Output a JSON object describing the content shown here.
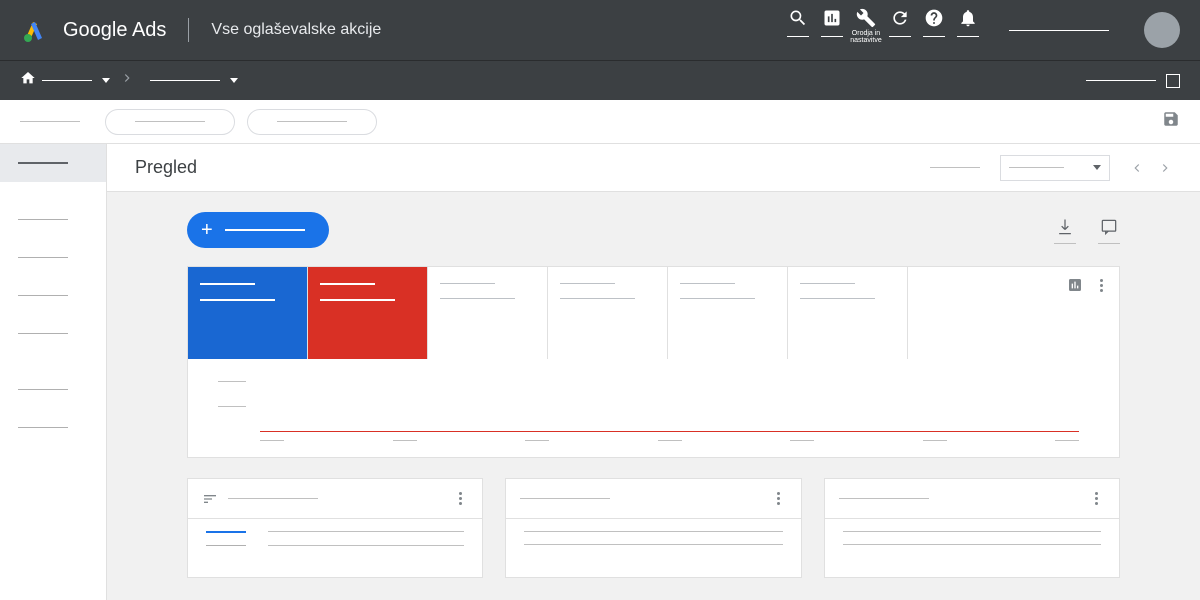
{
  "brand": "Google Ads",
  "subtitle": "Vse oglaševalske akcije",
  "tools_label": "Orodja in nastavitve",
  "page_title": "Pregled"
}
